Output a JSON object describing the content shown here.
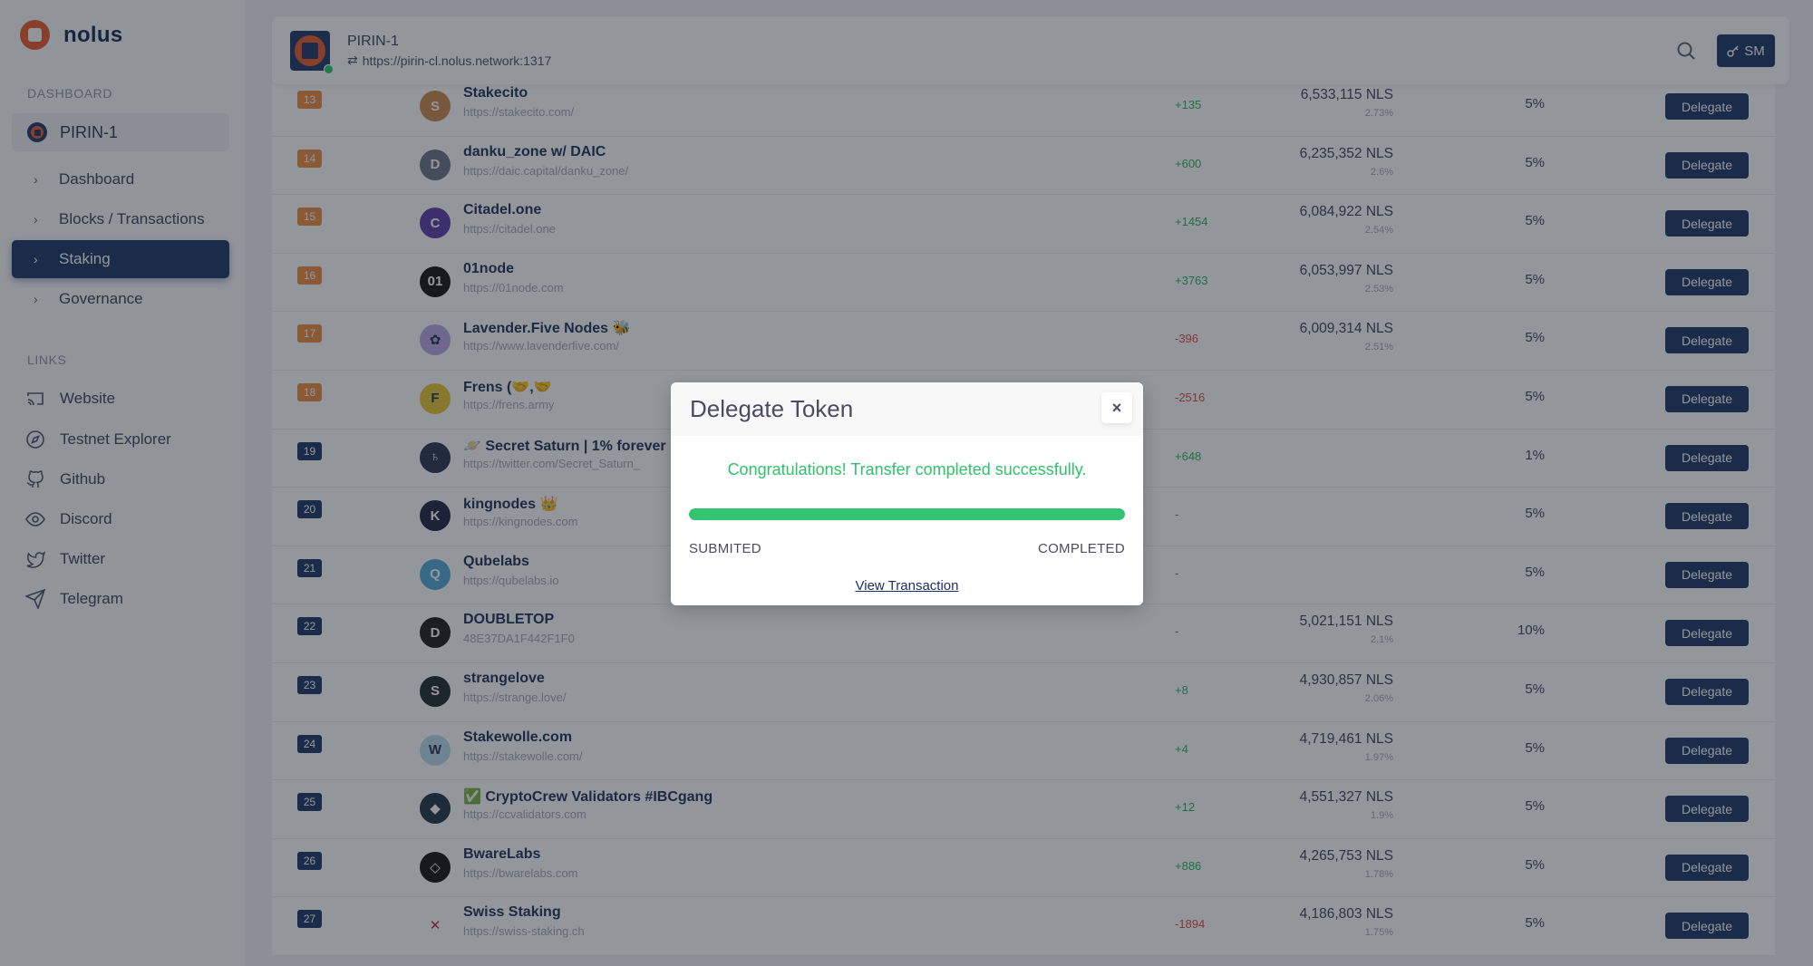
{
  "sidebar": {
    "brand": "nolus",
    "dashboard_label": "DASHBOARD",
    "chain": "PIRIN-1",
    "nav": [
      {
        "label": "Dashboard",
        "active": false
      },
      {
        "label": "Blocks / Transactions",
        "active": false
      },
      {
        "label": "Staking",
        "active": true
      },
      {
        "label": "Governance",
        "active": false
      }
    ],
    "links_label": "LINKS",
    "links": [
      {
        "label": "Website",
        "icon": "cast-icon"
      },
      {
        "label": "Testnet Explorer",
        "icon": "compass-icon"
      },
      {
        "label": "Github",
        "icon": "github-icon"
      },
      {
        "label": "Discord",
        "icon": "eye-icon"
      },
      {
        "label": "Twitter",
        "icon": "twitter-icon"
      },
      {
        "label": "Telegram",
        "icon": "send-icon"
      }
    ]
  },
  "header": {
    "chain": "PIRIN-1",
    "endpoint": "https://pirin-cl.nolus.network:1317",
    "sync_icon": "⇄",
    "wallet_label": "SM"
  },
  "colors": {
    "badge_top": "#ee8a3f",
    "badge_other": "#183563",
    "positive": "#28b45f",
    "negative": "#e04848",
    "accent": "#183563"
  },
  "validators": [
    {
      "rank": "13",
      "name": "Stakecito",
      "url": "https://stakecito.com/",
      "stake": "6,533,115 NLS",
      "share": "2.73%",
      "change": "+135",
      "commission": "5%",
      "avatar_color": "#c9884a",
      "avatar_text": "S",
      "top": true
    },
    {
      "rank": "14",
      "name": "danku_zone w/ DAIC",
      "url": "https://daic.capital/danku_zone/",
      "stake": "6,235,352 NLS",
      "share": "2.6%",
      "change": "+600",
      "commission": "5%",
      "avatar_color": "#6a7184",
      "avatar_text": "D",
      "top": true
    },
    {
      "rank": "15",
      "name": "Citadel.one",
      "url": "https://citadel.one",
      "stake": "6,084,922 NLS",
      "share": "2.54%",
      "change": "+1454",
      "commission": "5%",
      "avatar_color": "#5a3aa8",
      "avatar_text": "C",
      "top": true
    },
    {
      "rank": "16",
      "name": "01node",
      "url": "https://01node.com",
      "stake": "6,053,997 NLS",
      "share": "2.53%",
      "change": "+3763",
      "commission": "5%",
      "avatar_color": "#111111",
      "avatar_text": "01",
      "top": true
    },
    {
      "rank": "17",
      "name": "Lavender.Five Nodes 🐝",
      "url": "https://www.lavenderfive.com/",
      "stake": "6,009,314 NLS",
      "share": "2.51%",
      "change": "-396",
      "commission": "5%",
      "avatar_color": "#b9a6e6",
      "avatar_text": "✿",
      "top": true
    },
    {
      "rank": "18",
      "name": "Frens (🤝,🤝",
      "url": "https://frens.army",
      "stake": "",
      "share": "",
      "change": "-2516",
      "commission": "5%",
      "avatar_color": "#e8c630",
      "avatar_text": "F",
      "top": true
    },
    {
      "rank": "19",
      "name": "🪐 Secret Saturn | 1% forever",
      "url": "https://twitter.com/Secret_Saturn_",
      "stake": "",
      "share": "",
      "change": "+648",
      "commission": "1%",
      "avatar_color": "#2a3450",
      "avatar_text": "♄",
      "top": false
    },
    {
      "rank": "20",
      "name": "kingnodes 👑",
      "url": "https://kingnodes.com",
      "stake": "",
      "share": "",
      "change": "-",
      "commission": "5%",
      "avatar_color": "#1d2440",
      "avatar_text": "K",
      "top": false
    },
    {
      "rank": "21",
      "name": "Qubelabs",
      "url": "https://qubelabs.io",
      "stake": "",
      "share": "",
      "change": "-",
      "commission": "5%",
      "avatar_color": "#4fa9d6",
      "avatar_text": "Q",
      "top": false
    },
    {
      "rank": "22",
      "name": "DOUBLETOP",
      "url": "48E37DA1F442F1F0",
      "stake": "5,021,151 NLS",
      "share": "2.1%",
      "change": "-",
      "commission": "10%",
      "avatar_color": "#1a1a1a",
      "avatar_text": "D",
      "top": false
    },
    {
      "rank": "23",
      "name": "strangelove",
      "url": "https://strange.love/",
      "stake": "4,930,857 NLS",
      "share": "2.06%",
      "change": "+8",
      "commission": "5%",
      "avatar_color": "#1e2a28",
      "avatar_text": "S",
      "top": false
    },
    {
      "rank": "24",
      "name": "Stakewolle.com",
      "url": "https://stakewolle.com/",
      "stake": "4,719,461 NLS",
      "share": "1.97%",
      "change": "+4",
      "commission": "5%",
      "avatar_color": "#b8d8e8",
      "avatar_text": "W",
      "top": false
    },
    {
      "rank": "25",
      "name": "✅ CryptoCrew Validators #IBCgang",
      "url": "https://ccvalidators.com",
      "stake": "4,551,327 NLS",
      "share": "1.9%",
      "change": "+12",
      "commission": "5%",
      "avatar_color": "#1f3445",
      "avatar_text": "◆",
      "top": false
    },
    {
      "rank": "26",
      "name": "BwareLabs",
      "url": "https://bwarelabs.com",
      "stake": "4,265,753 NLS",
      "share": "1.78%",
      "change": "+886",
      "commission": "5%",
      "avatar_color": "#111111",
      "avatar_text": "◇",
      "top": false
    },
    {
      "rank": "27",
      "name": "Swiss Staking",
      "url": "https://swiss-staking.ch",
      "stake": "4,186,803 NLS",
      "share": "1.75%",
      "change": "-1894",
      "commission": "5%",
      "avatar_color": "#ffffff",
      "avatar_text": "✕",
      "top": false
    }
  ],
  "delegate_label": "Delegate",
  "modal": {
    "title": "Delegate Token",
    "close": "×",
    "message": "Congratulations! Transfer completed successfully.",
    "progress_percent": 100,
    "step_start": "SUBMITED",
    "step_end": "COMPLETED",
    "link": "View Transaction"
  }
}
